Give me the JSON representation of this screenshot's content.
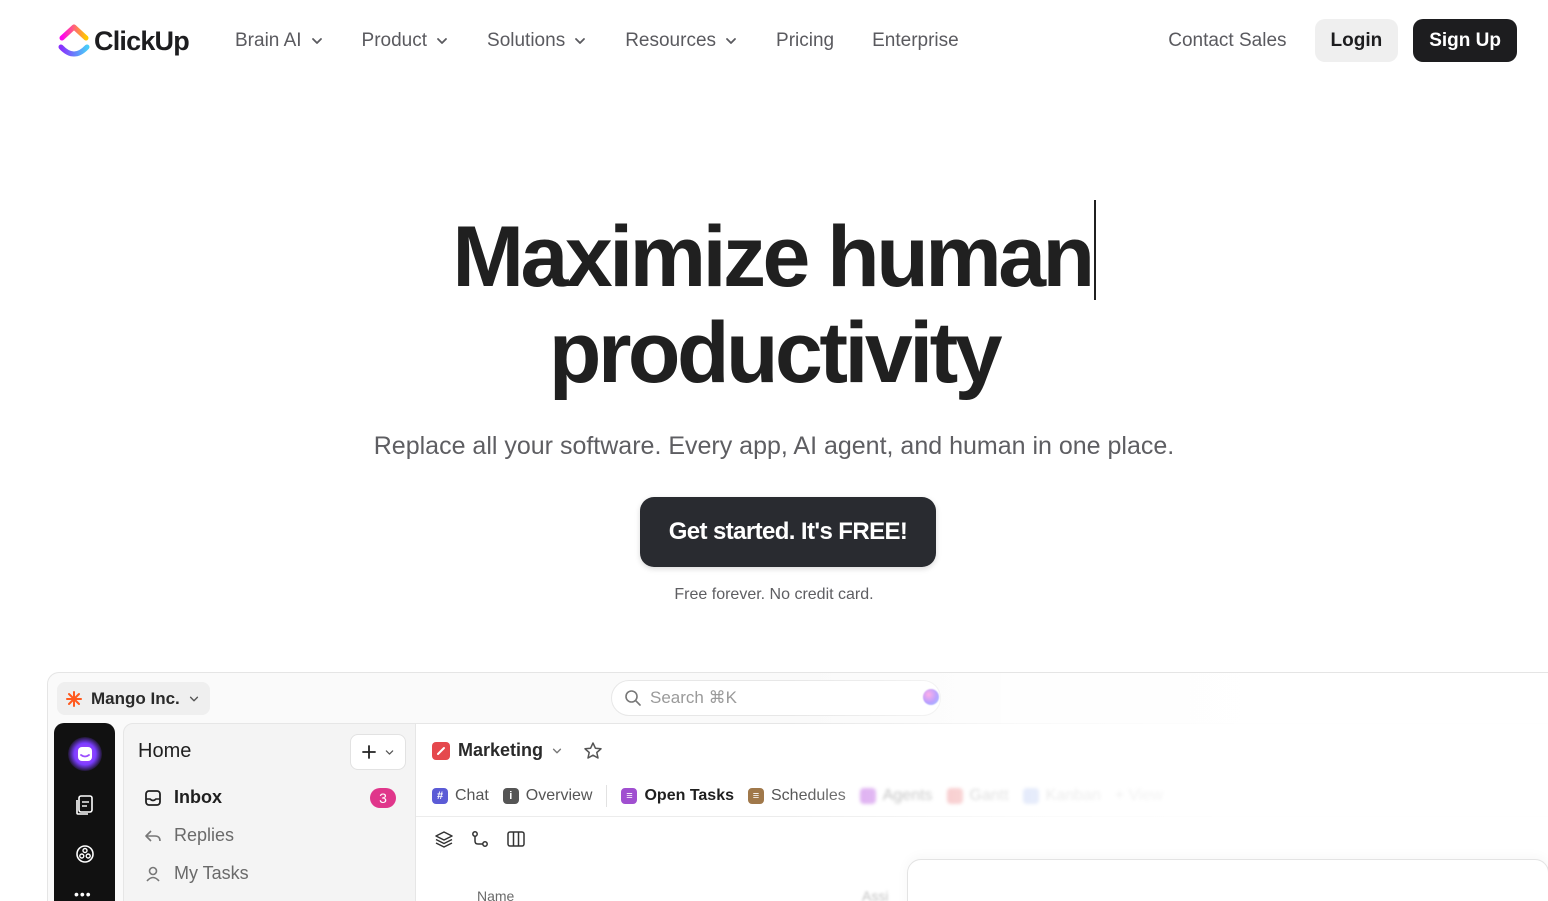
{
  "brand": {
    "name": "ClickUp"
  },
  "nav": {
    "items": [
      {
        "label": "Brain AI",
        "dropdown": true
      },
      {
        "label": "Product",
        "dropdown": true
      },
      {
        "label": "Solutions",
        "dropdown": true
      },
      {
        "label": "Resources",
        "dropdown": true
      },
      {
        "label": "Pricing",
        "dropdown": false
      },
      {
        "label": "Enterprise",
        "dropdown": false
      }
    ],
    "contact_label": "Contact Sales",
    "login_label": "Login",
    "signup_label": "Sign Up"
  },
  "hero": {
    "title_line1": "Maximize human",
    "title_line2": "productivity",
    "subtitle": "Replace all your software. Every app, AI agent, and human in one place.",
    "cta_label": "Get started. It's FREE!",
    "cta_note": "Free forever. No credit card."
  },
  "app": {
    "workspace": "Mango Inc.",
    "search_placeholder": "Search ⌘K",
    "sidebar": {
      "title": "Home",
      "items": [
        {
          "label": "Inbox",
          "icon": "inbox-icon",
          "badge": "3",
          "active": true
        },
        {
          "label": "Replies",
          "icon": "reply-icon"
        },
        {
          "label": "My Tasks",
          "icon": "person-icon"
        }
      ]
    },
    "main": {
      "title": "Marketing",
      "tabs": [
        {
          "label": "Chat",
          "icon": "hash-icon",
          "color": "#5b5bd6"
        },
        {
          "label": "Overview",
          "icon": "info-icon",
          "color": "#555555"
        },
        {
          "label": "Open Tasks",
          "icon": "list-icon",
          "color": "#a04fd0",
          "active": true
        },
        {
          "label": "Schedules",
          "icon": "schedule-icon",
          "color": "#a0784a"
        },
        {
          "label": "Agents",
          "icon": "agent-icon",
          "color": "#b44ae0"
        },
        {
          "label": "Gantt",
          "icon": "gantt-icon",
          "color": "#e5484d"
        },
        {
          "label": "Kanban",
          "icon": "kanban-icon",
          "color": "#3d6be0"
        },
        {
          "label": "+ View",
          "icon": "plus-icon"
        }
      ],
      "column_name": "Name",
      "column_assignee": "Assi"
    }
  },
  "colors": {
    "primary_dark": "#1d1d1f",
    "cta": "#292b30",
    "badge": "#e0368b",
    "marketing": "#e5484d"
  }
}
